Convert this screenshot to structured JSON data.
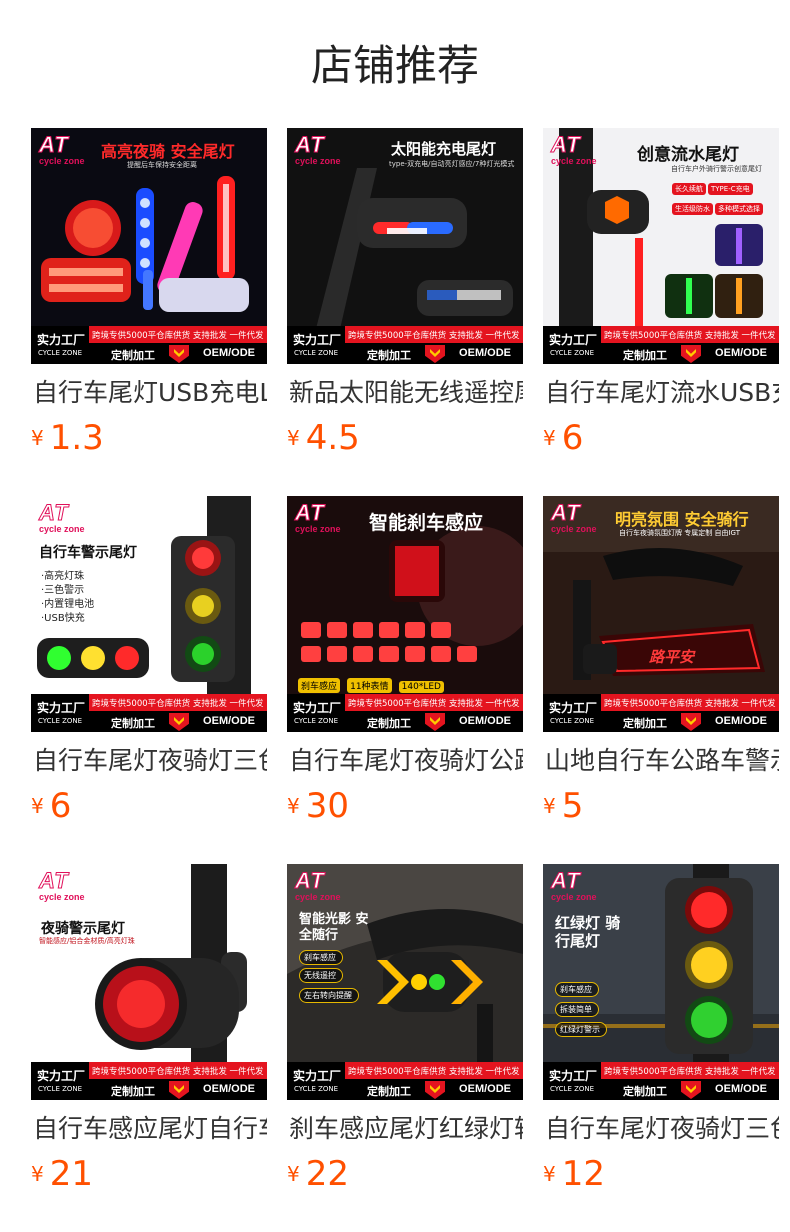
{
  "page": {
    "title": "店铺推荐",
    "currency_symbol": "¥",
    "price_color": "#ff5000"
  },
  "banner": {
    "brand_logo": "AT",
    "brand_name": "cycle zone",
    "factory": "实力工厂",
    "factory_sub": "CYCLE ZONE",
    "promo": "跨境专供5000平仓库供货 支持批发 一件代发",
    "custom": "定制加工",
    "oem": "OEM/ODE"
  },
  "products": [
    {
      "name": "自行车尾灯USB充电LED",
      "price": "1.3",
      "headline": "高亮夜骑 安全尾灯",
      "subline": "提醒后车保持安全距离"
    },
    {
      "name": "新品太阳能无线遥控尾灯",
      "price": "4.5",
      "headline": "太阳能充电尾灯",
      "subline": "type-双充电/自动亮灯感应/7种灯光模式"
    },
    {
      "name": "自行车尾灯流水USB充电",
      "price": "6",
      "headline": "创意流水尾灯",
      "subline": "自行车户外骑行警示创意尾灯",
      "pills": [
        "长久续航",
        "TYPE-C充电",
        "生活级防水",
        "多种模式选择"
      ]
    },
    {
      "name": "自行车尾灯夜骑灯三色警示",
      "price": "6",
      "headline": "自行车警示尾灯",
      "bullets": [
        "·高亮灯珠",
        "·三色警示",
        "·内置锂电池",
        "·USB快充"
      ]
    },
    {
      "name": "自行车尾灯夜骑灯公路车",
      "price": "30",
      "headline": "智能刹车感应",
      "tags": [
        "刹车感应",
        "11种表情",
        "140*LED"
      ]
    },
    {
      "name": "山地自行车公路车警示尾灯",
      "price": "5",
      "headline": "明亮氛围 安全骑行",
      "subline": "自行车夜骑氛围灯牌 专属定制 自由IGT",
      "sign_text": "路平安"
    },
    {
      "name": "自行车感应尾灯自行车尾灯",
      "price": "21",
      "headline": "夜骑警示尾灯",
      "subline": "智能感应/铝合金材质/高亮灯珠"
    },
    {
      "name": "刹车感应尾灯红绿灯转向",
      "price": "22",
      "headline": "智能光影 安全随行",
      "tags": [
        "刹车感应",
        "无线遥控",
        "左右转向提醒"
      ]
    },
    {
      "name": "自行车尾灯夜骑灯三色红绿灯",
      "price": "12",
      "headline": "红绿灯 骑行尾灯",
      "tags": [
        "刹车感应",
        "拆装简单",
        "红绿灯警示"
      ]
    }
  ]
}
